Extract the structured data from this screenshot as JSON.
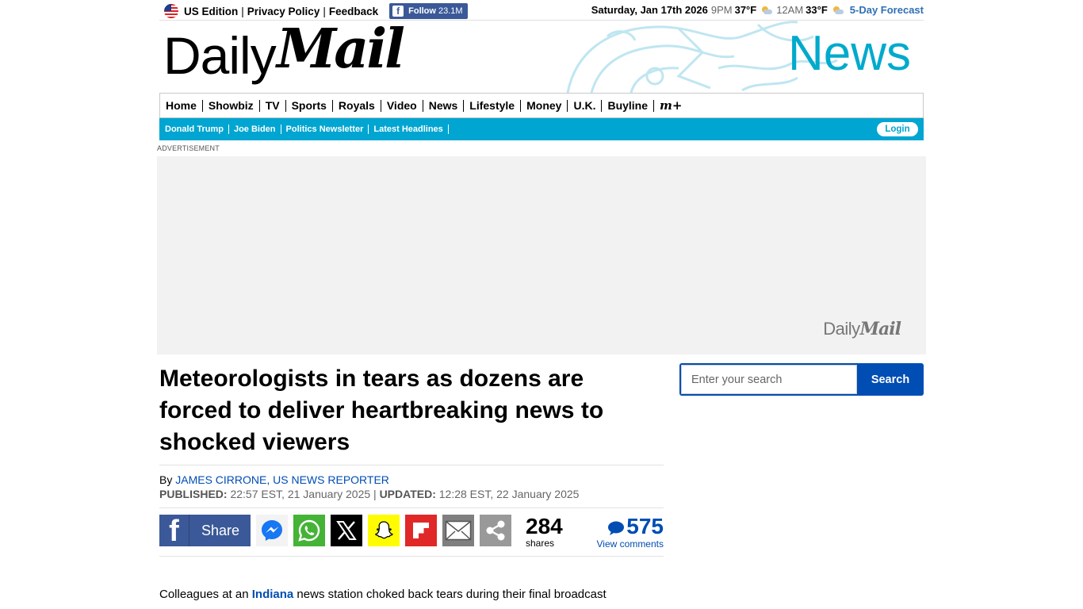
{
  "topbar": {
    "edition": "US Edition",
    "privacy": "Privacy Policy",
    "feedback": "Feedback",
    "follow_label": "Follow",
    "follow_count": "23.1M",
    "date": "Saturday, Jan 17th 2026",
    "time1": "9PM",
    "temp1": "37°F",
    "time2": "12AM",
    "temp2": "33°F",
    "forecast": "5-Day Forecast"
  },
  "masthead": {
    "logo_daily": "Daily",
    "logo_mail": "Mail",
    "channel": "News"
  },
  "nav": {
    "items": [
      "Home",
      "Showbiz",
      "TV",
      "Sports",
      "Royals",
      "Video",
      "News",
      "Lifestyle",
      "Money",
      "U.K.",
      "Buyline"
    ],
    "mplus": "m+"
  },
  "subnav": {
    "items": [
      "Donald Trump",
      "Joe Biden",
      "Politics Newsletter",
      "Latest Headlines"
    ],
    "login": "Login"
  },
  "ad": {
    "label": "ADVERTISEMENT",
    "logo_daily": "Daily",
    "logo_mail": "Mail"
  },
  "article": {
    "headline": "Meteorologists in tears as dozens are forced to deliver heartbreaking news to shocked viewers",
    "by": "By",
    "author": "JAMES CIRRONE, US NEWS REPORTER",
    "published_label": "PUBLISHED:",
    "published": "22:57 EST, 21 January 2025",
    "date_sep": "|",
    "updated_label": "UPDATED:",
    "updated": "12:28 EST, 22 January 2025",
    "share_label": "Share",
    "shares_count": "284",
    "shares_label": "shares",
    "comments_count": "575",
    "comments_label": "View comments",
    "body_start": "Colleagues at an ",
    "body_link": "Indiana",
    "body_rest": " news station choked back tears during their final broadcast"
  },
  "search": {
    "placeholder": "Enter your search",
    "button": "Search"
  },
  "colors": {
    "accent": "#00a5d1",
    "link": "#004db3",
    "facebook": "#3b5998"
  },
  "icons": [
    "us-flag-icon",
    "facebook-icon",
    "weather-icon",
    "messenger-icon",
    "whatsapp-icon",
    "x-icon",
    "snapchat-icon",
    "flipboard-icon",
    "email-icon",
    "share-icon",
    "comment-icon"
  ]
}
